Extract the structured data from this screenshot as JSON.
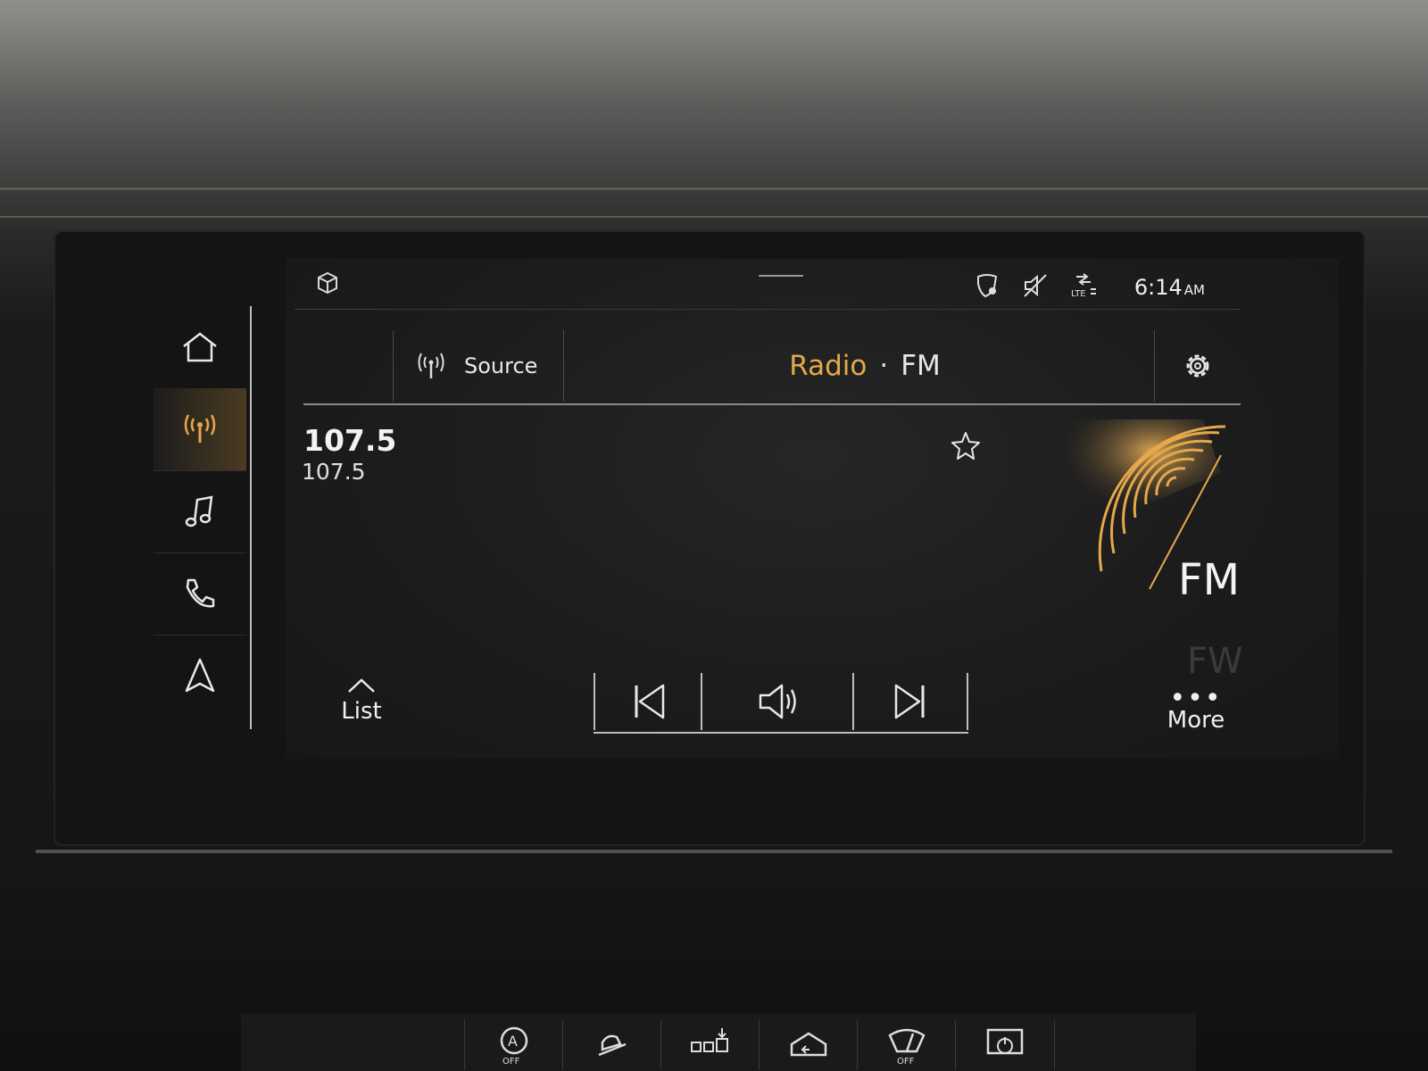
{
  "status_bar": {
    "time": "6:14",
    "ampm": "AM",
    "icons": [
      "cube-icon",
      "location-shield-icon",
      "mute-icon",
      "lte-signal-icon"
    ]
  },
  "sidebar": {
    "items": [
      {
        "name": "home",
        "icon": "home-icon",
        "active": false
      },
      {
        "name": "media-radio",
        "icon": "radio-antenna-icon",
        "active": true
      },
      {
        "name": "music",
        "icon": "music-note-icon",
        "active": false
      },
      {
        "name": "phone",
        "icon": "phone-icon",
        "active": false
      },
      {
        "name": "navigation",
        "icon": "navigation-arrow-icon",
        "active": false
      }
    ]
  },
  "header": {
    "source_label": "Source",
    "title_radio": "Radio",
    "title_sep": "·",
    "title_band": "FM"
  },
  "station": {
    "frequency": "107.5",
    "name": "107.5"
  },
  "art": {
    "band_label": "FM",
    "ghost_label": "FW"
  },
  "controls": {
    "list_label": "List",
    "more_dots": "•••",
    "more_label": "More"
  },
  "colors": {
    "accent": "#e6a84a",
    "text": "#eaeaea",
    "background": "#1c1c1c"
  },
  "lower_panel": {
    "buttons": [
      {
        "icon": "auto-start-stop-off-icon",
        "label": "OFF"
      },
      {
        "icon": "hill-descent-icon"
      },
      {
        "icon": "parking-sensor-icon"
      },
      {
        "icon": "garage-door-icon"
      },
      {
        "icon": "wiper-off-icon",
        "label": "OFF"
      },
      {
        "icon": "screen-power-icon"
      }
    ]
  }
}
